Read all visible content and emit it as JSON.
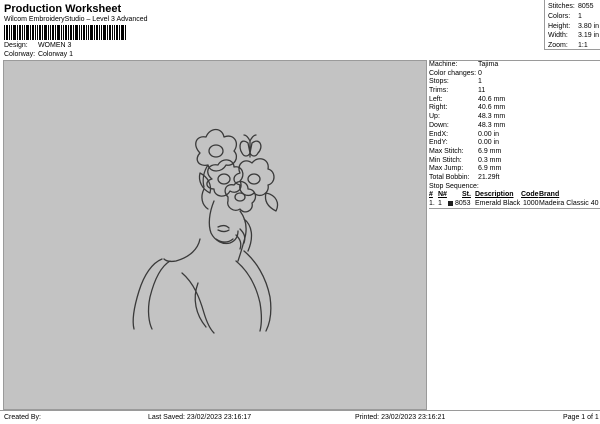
{
  "header": {
    "title": "Production Worksheet",
    "subtitle": "Wilcom EmbroideryStudio – Level 3 Advanced"
  },
  "design": {
    "label": "Design:",
    "value": "WOMEN 3"
  },
  "colorway": {
    "label": "Colorway:",
    "value": "Colorway 1"
  },
  "top_stats": [
    {
      "label": "Stitches:",
      "value": "8055"
    },
    {
      "label": "Colors:",
      "value": "1"
    },
    {
      "label": "Height:",
      "value": "3.80 in"
    },
    {
      "label": "Width:",
      "value": "3.19 in"
    },
    {
      "label": "Zoom:",
      "value": "1:1"
    }
  ],
  "machine_info": [
    {
      "label": "Machine:",
      "value": "Tajima"
    },
    {
      "label": "Color changes:",
      "value": "0"
    },
    {
      "label": "Stops:",
      "value": "1"
    },
    {
      "label": "Trims:",
      "value": "11"
    },
    {
      "label": "Left:",
      "value": "40.6 mm"
    },
    {
      "label": "Right:",
      "value": "40.6 mm"
    },
    {
      "label": "Up:",
      "value": "48.3 mm"
    },
    {
      "label": "Down:",
      "value": "48.3 mm"
    },
    {
      "label": "EndX:",
      "value": "0.00 in"
    },
    {
      "label": "EndY:",
      "value": "0.00 in"
    },
    {
      "label": "Max Stitch:",
      "value": "6.9 mm"
    },
    {
      "label": "Min Stitch:",
      "value": "0.3 mm"
    },
    {
      "label": "Max Jump:",
      "value": "6.9 mm"
    },
    {
      "label": "Total Bobbin:",
      "value": "21.29ft"
    }
  ],
  "stop_sequence": {
    "label": "Stop Sequence:",
    "headers": {
      "num": "#",
      "n": "N#",
      "st": "St.",
      "description": "Description",
      "code": "Code",
      "brand": "Brand"
    },
    "rows": [
      {
        "num": "1.",
        "n": "1",
        "st": "8053",
        "description": "Emerald Black",
        "code": "1000",
        "brand": "Madeira Classic 40",
        "color": "#1e1e1e"
      }
    ]
  },
  "footer": {
    "created_by": "Created By:",
    "last_saved": "Last Saved: 23/02/2023 23:16:17",
    "printed": "Printed: 23/02/2023 23:16:21",
    "page": "Page 1 of 1"
  },
  "colors": {
    "canvas_bg": "#c3c3c3",
    "stitch": "#3a3a3a"
  }
}
